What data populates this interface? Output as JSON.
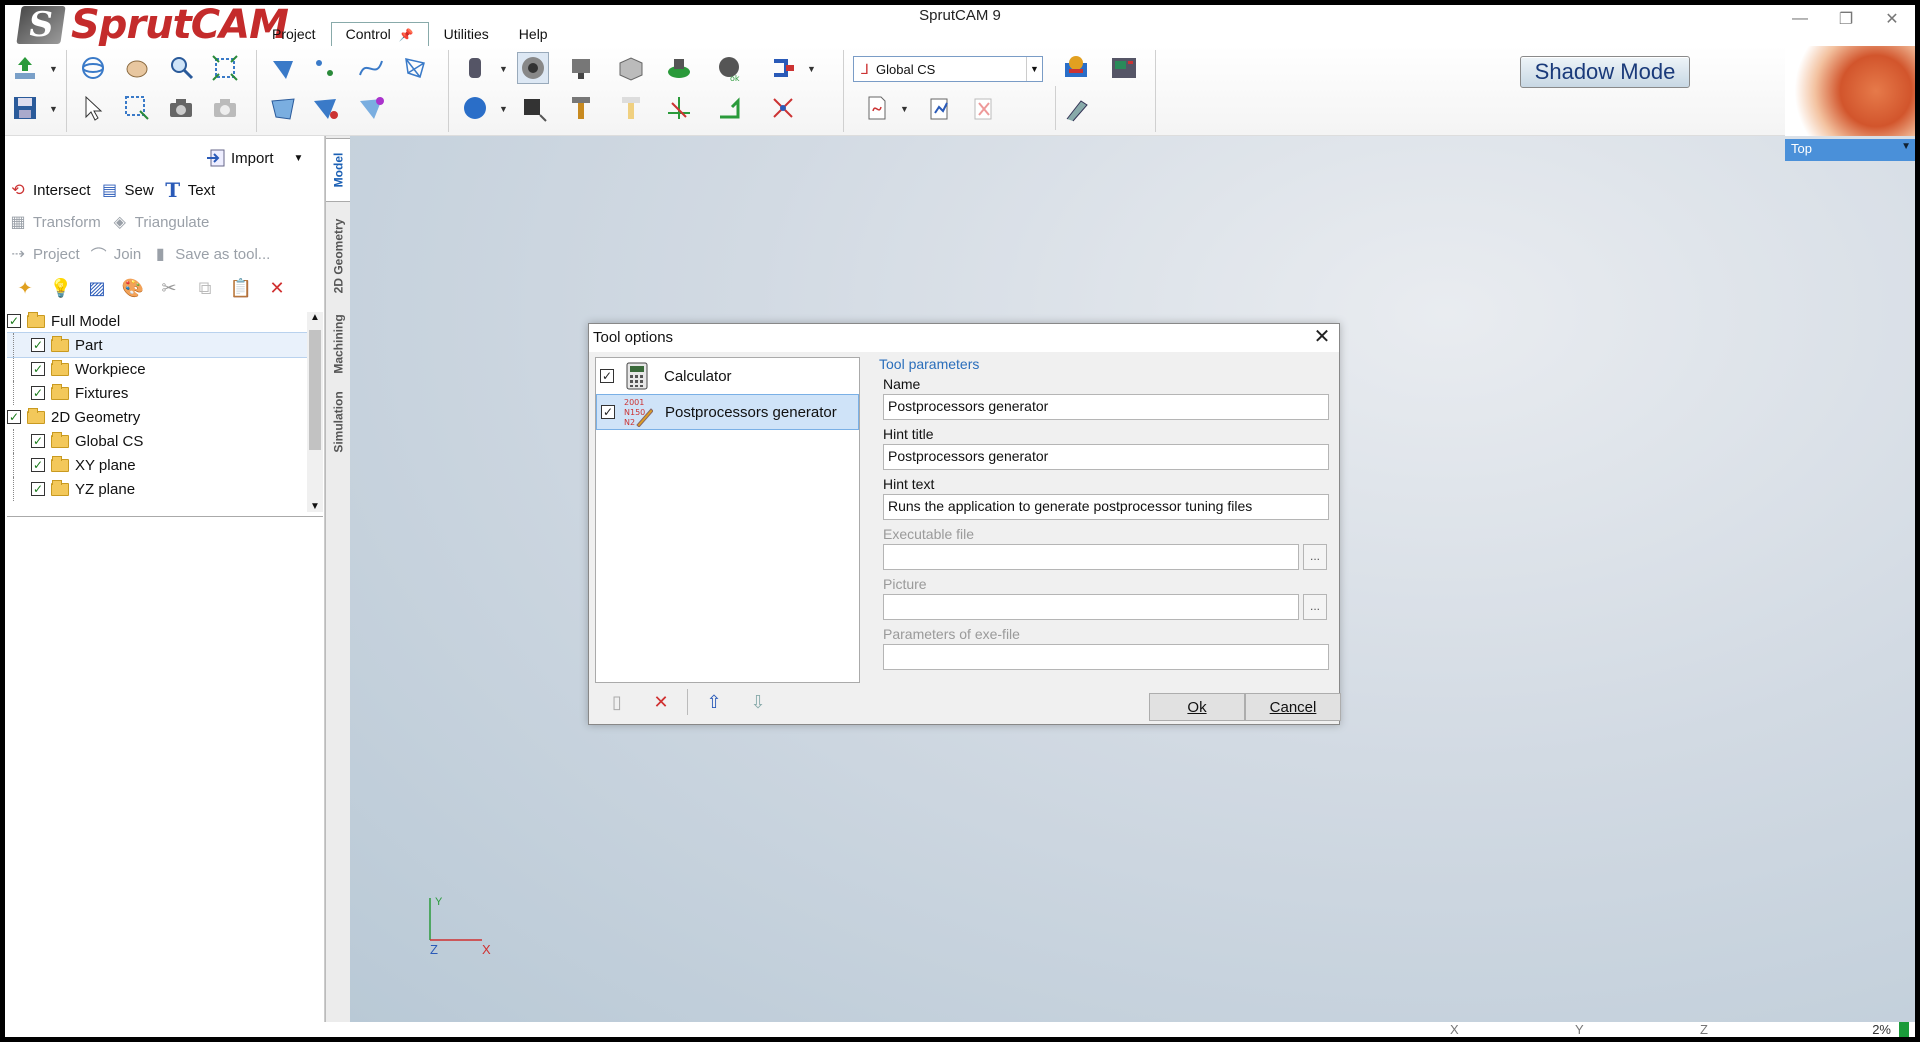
{
  "app": {
    "title": "SprutCAM 9",
    "logo_text": "SprutCAM",
    "logo_letter": "S"
  },
  "menu": [
    {
      "label": "Project"
    },
    {
      "label": "Control",
      "active": true
    },
    {
      "label": "Utilities"
    },
    {
      "label": "Help"
    }
  ],
  "window_controls": {
    "minimize": "—",
    "restore": "❐",
    "close": "✕"
  },
  "ribbon": {
    "cs_select_value": "Global CS",
    "shadow_mode_label": "Shadow Mode"
  },
  "left_panel": {
    "import_label": "Import",
    "tools_row1": [
      {
        "label": "Intersect",
        "icon": "intersect-icon"
      },
      {
        "label": "Sew",
        "icon": "sew-icon"
      },
      {
        "label": "Text",
        "icon": "text-icon"
      }
    ],
    "tools_row2": [
      {
        "label": "Transform",
        "icon": "transform-icon",
        "disabled": true
      },
      {
        "label": "Triangulate",
        "icon": "triangulate-icon",
        "disabled": true
      }
    ],
    "tools_row3": [
      {
        "label": "Project",
        "icon": "project-icon",
        "disabled": true
      },
      {
        "label": "Join",
        "icon": "join-icon",
        "disabled": true
      },
      {
        "label": "Save as tool...",
        "icon": "save-as-tool-icon",
        "disabled": true
      }
    ],
    "vertical_tabs": [
      {
        "label": "Model",
        "active": true
      },
      {
        "label": "2D Geometry"
      },
      {
        "label": "Machining"
      },
      {
        "label": "Simulation"
      }
    ],
    "tree": [
      {
        "label": "Full Model",
        "level": 0
      },
      {
        "label": "Part",
        "level": 1,
        "selected": true
      },
      {
        "label": "Workpiece",
        "level": 1
      },
      {
        "label": "Fixtures",
        "level": 1
      },
      {
        "label": "2D Geometry",
        "level": 0
      },
      {
        "label": "Global CS",
        "level": 1
      },
      {
        "label": "XY plane",
        "level": 1
      },
      {
        "label": "YZ plane",
        "level": 1
      }
    ]
  },
  "viewport": {
    "view_label": "Top",
    "axis_y": "Y",
    "axis_z": "Z",
    "axis_x": "X"
  },
  "statusbar": {
    "x_label": "X",
    "y_label": "Y",
    "z_label": "Z",
    "progress": "2%"
  },
  "dialog": {
    "title": "Tool options",
    "tools": [
      {
        "label": "Calculator",
        "checked": true,
        "icon": "calculator-icon"
      },
      {
        "label": "Postprocessors generator",
        "checked": true,
        "icon": "postprocessor-icon",
        "selected": true
      }
    ],
    "params_header": "Tool parameters",
    "name_label": "Name",
    "name_value": "Postprocessors generator",
    "hint_title_label": "Hint title",
    "hint_title_value": "Postprocessors generator",
    "hint_text_label": "Hint text",
    "hint_text_value": "Runs the application to generate postprocessor tuning files",
    "exe_label": "Executable file",
    "exe_value": "",
    "picture_label": "Picture",
    "picture_value": "",
    "params_label": "Parameters of exe-file",
    "params_value": "",
    "browse_label": "...",
    "ok_label": "Ok",
    "cancel_label": "Cancel"
  }
}
